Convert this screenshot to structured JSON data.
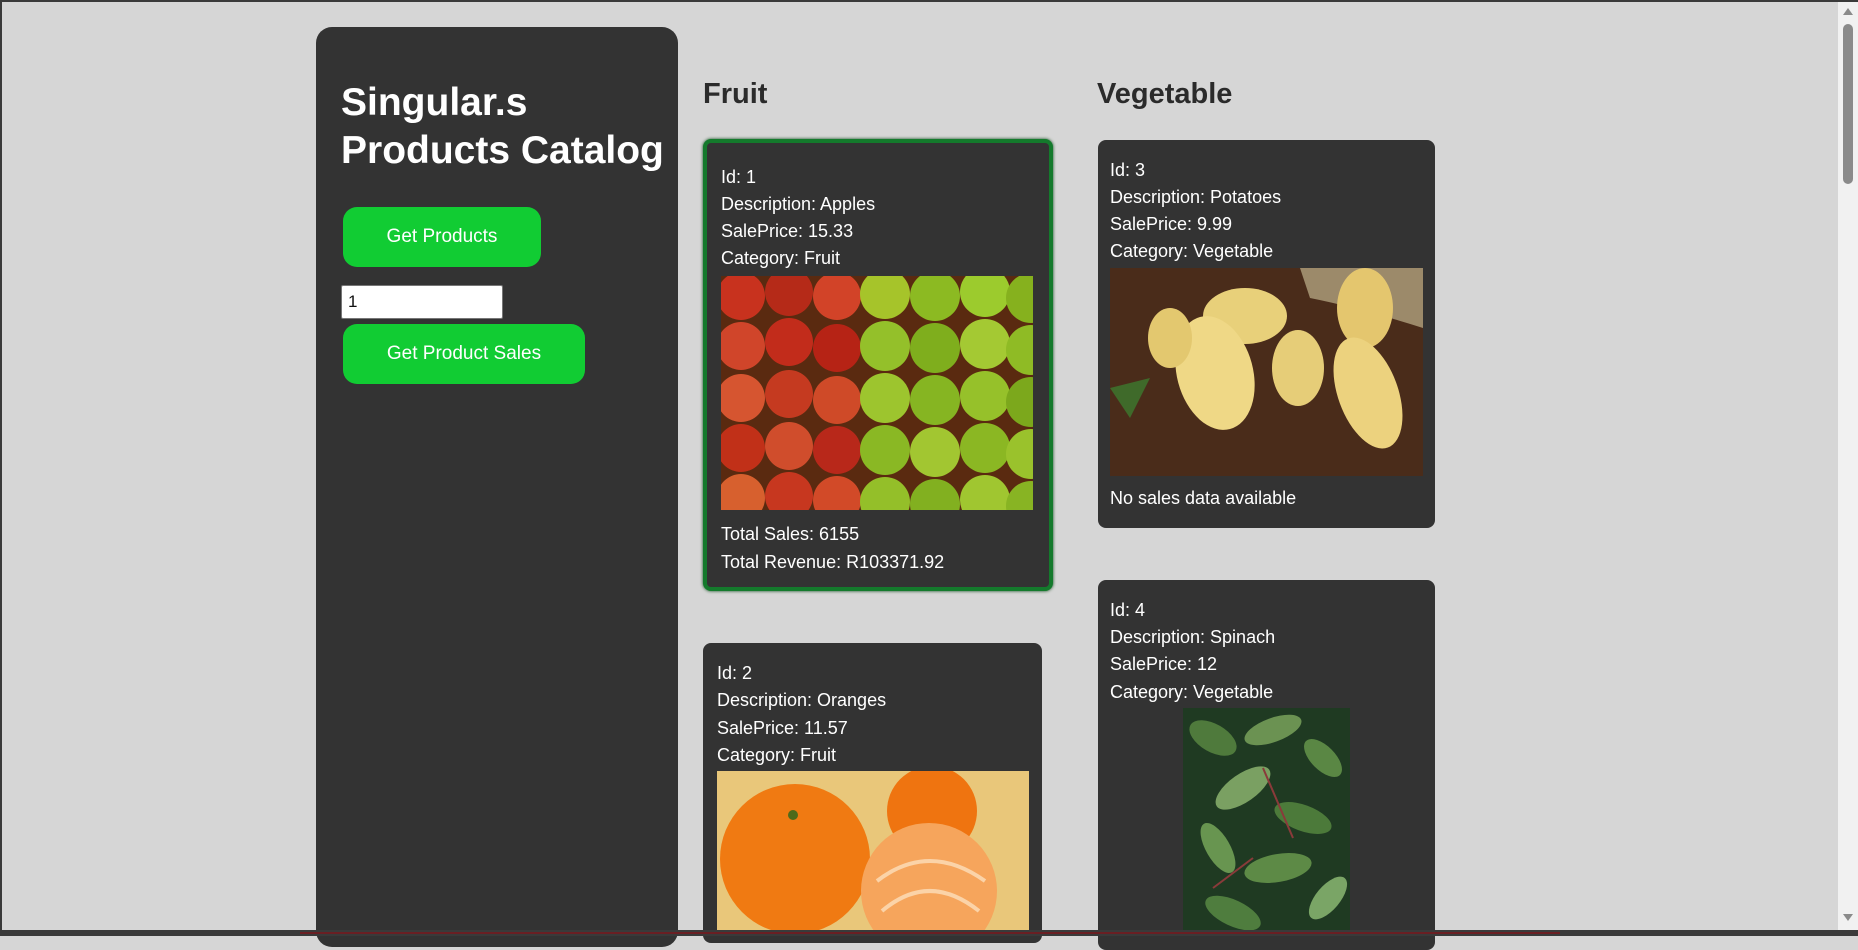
{
  "sidebar": {
    "title_line1": "Singular.s",
    "title_line2": "Products Catalog",
    "get_products_label": "Get Products",
    "product_id_value": "1",
    "get_sales_label": "Get Product Sales"
  },
  "columns": {
    "fruit_title": "Fruit",
    "vegetable_title": "Vegetable"
  },
  "products": {
    "apples": {
      "id": "Id: 1",
      "description": "Description: Apples",
      "price": "SalePrice: 15.33",
      "category": "Category: Fruit",
      "total_sales": "Total Sales: 6155",
      "total_revenue": "Total Revenue: R103371.92",
      "selected": true
    },
    "oranges": {
      "id": "Id: 2",
      "description": "Description: Oranges",
      "price": "SalePrice: 11.57",
      "category": "Category: Fruit"
    },
    "potatoes": {
      "id": "Id: 3",
      "description": "Description: Potatoes",
      "price": "SalePrice: 9.99",
      "category": "Category: Vegetable",
      "sales_note": "No sales data available"
    },
    "spinach": {
      "id": "Id: 4",
      "description": "Description: Spinach",
      "price": "SalePrice: 12",
      "category": "Category: Vegetable"
    }
  },
  "colors": {
    "page_bg": "#d6d6d6",
    "panel_bg": "#333333",
    "button_green": "#11cc33",
    "selected_border": "#147a2c"
  }
}
